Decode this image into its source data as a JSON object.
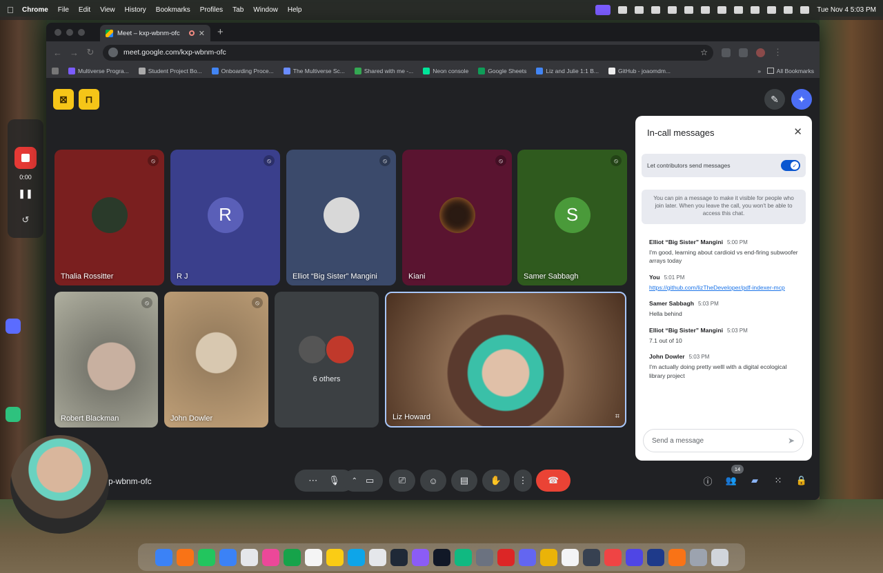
{
  "menubar": {
    "app": "Chrome",
    "menus": [
      "File",
      "Edit",
      "View",
      "History",
      "Bookmarks",
      "Profiles",
      "Tab",
      "Window",
      "Help"
    ],
    "clock": "Tue Nov 4  5:03 PM"
  },
  "browser": {
    "tab_title": "Meet – kxp-wbnm-ofc",
    "url": "meet.google.com/kxp-wbnm-ofc",
    "bookmarks": [
      "Multiverse Progra...",
      "Student Project Bo...",
      "Onboarding Proce...",
      "The Multiverse Sc...",
      "Shared with me -...",
      "Neon console",
      "Google Sheets",
      "Liz and Julie 1:1 B...",
      "GitHub - joaomdm..."
    ],
    "all_bookmarks": "All Bookmarks"
  },
  "recorder": {
    "timer": "0:00"
  },
  "meet": {
    "code": "kxp-wbnm-ofc",
    "code_visible": "p-wbnm-ofc",
    "people_count": "14",
    "tiles": [
      {
        "name": "Thalia Rossitter",
        "color": "#7a1f1f"
      },
      {
        "name": "R J",
        "initial": "R",
        "color": "#3a3f8c"
      },
      {
        "name": "Elliot “Big Sister” Mangini",
        "color": "#3b4a6b"
      },
      {
        "name": "Kiani",
        "color": "#5a1430"
      },
      {
        "name": "Samer Sabbagh",
        "initial": "S",
        "color": "#2f5a1e"
      },
      {
        "name": "Robert Blackman",
        "color": "#8a8a80"
      },
      {
        "name": "John Dowler",
        "color": "#a89070"
      },
      {
        "name": "6 others",
        "color": "#3c4043"
      },
      {
        "name": "Liz Howard",
        "color": "#6a4a3a"
      }
    ]
  },
  "chat": {
    "title": "In-call messages",
    "toggle_label": "Let contributors send messages",
    "pin_note": "You can pin a message to make it visible for people who join later. When you leave the call, you won't be able to access this chat.",
    "messages": [
      {
        "sender": "Elliot “Big Sister” Mangini",
        "time": "5:00 PM",
        "text": "I'm good, learning about cardioid vs end-firing subwoofer arrays today"
      },
      {
        "sender": "You",
        "time": "5:01 PM",
        "text": "https://github.com/lizTheDeveloper/pdf-indexer-mcp"
      },
      {
        "sender": "Samer Sabbagh",
        "time": "5:03 PM",
        "text": "Hella behind"
      },
      {
        "sender": "Elliot “Big Sister” Mangini",
        "time": "5:03 PM",
        "text": "7.1 out of 10"
      },
      {
        "sender": "John Dowler",
        "time": "5:03 PM",
        "text": "I'm actually doing pretty welll with a digital ecological library project"
      }
    ],
    "input_placeholder": "Send a message"
  },
  "icons": {
    "mute": "🎙",
    "close": "✕",
    "send": "➤"
  }
}
